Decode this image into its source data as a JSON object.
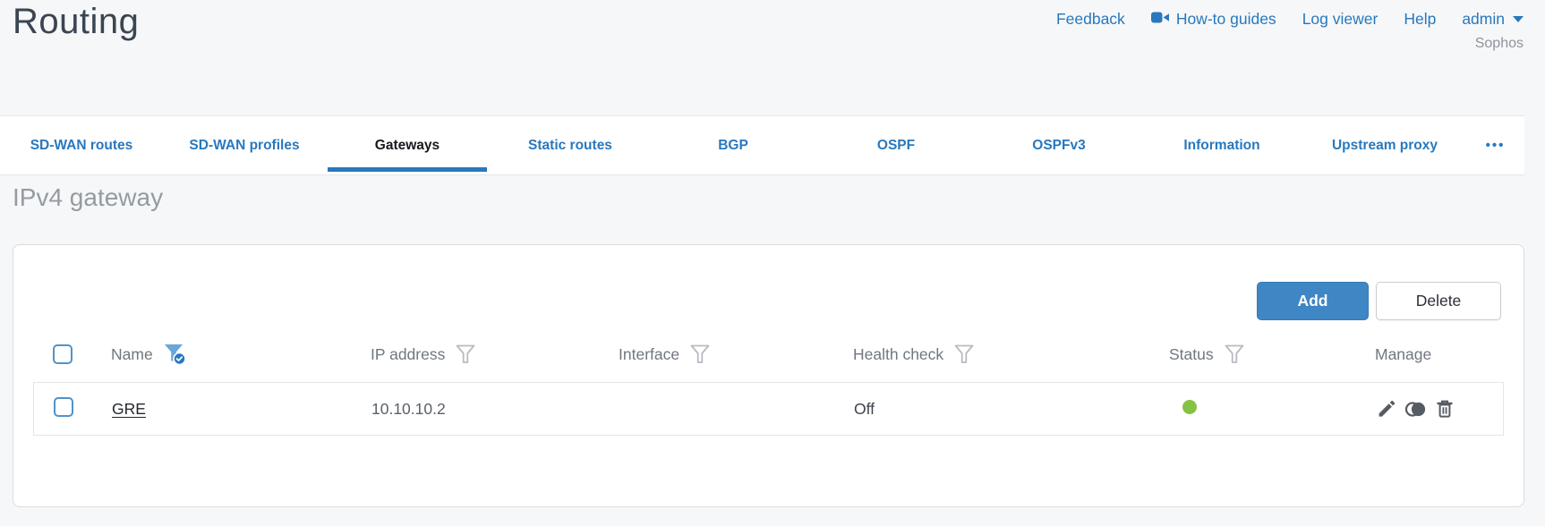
{
  "page": {
    "title": "Routing",
    "brand": "Sophos"
  },
  "header_links": {
    "feedback": "Feedback",
    "howto": "How-to guides",
    "log_viewer": "Log viewer",
    "help": "Help",
    "admin": "admin"
  },
  "tabs": {
    "items": [
      {
        "label": "SD-WAN routes",
        "active": false
      },
      {
        "label": "SD-WAN profiles",
        "active": false
      },
      {
        "label": "Gateways",
        "active": true
      },
      {
        "label": "Static routes",
        "active": false
      },
      {
        "label": "BGP",
        "active": false
      },
      {
        "label": "OSPF",
        "active": false
      },
      {
        "label": "OSPFv3",
        "active": false
      },
      {
        "label": "Information",
        "active": false
      },
      {
        "label": "Upstream proxy",
        "active": false
      }
    ],
    "more_label": "•••"
  },
  "section": {
    "title": "IPv4 gateway"
  },
  "toolbar": {
    "add_label": "Add",
    "delete_label": "Delete"
  },
  "table": {
    "columns": [
      {
        "label": "Name",
        "filter": "active"
      },
      {
        "label": "IP address",
        "filter": "inactive"
      },
      {
        "label": "Interface",
        "filter": "inactive"
      },
      {
        "label": "Health check",
        "filter": "inactive"
      },
      {
        "label": "Status",
        "filter": "inactive"
      },
      {
        "label": "Manage",
        "filter": "none"
      }
    ],
    "rows": [
      {
        "name": "GRE",
        "ip_address": "10.10.10.2",
        "interface": "",
        "health_check": "Off",
        "status": "up",
        "manage": [
          "edit-icon",
          "clone-icon",
          "delete-icon"
        ]
      }
    ]
  },
  "colors": {
    "accent_blue": "#2878be",
    "button_blue": "#3f86c5",
    "status_green": "#84c341",
    "active_filter_fill": "#6ba5d9",
    "icon_gray": "#565c63",
    "page_background": "#f6f7f8"
  }
}
